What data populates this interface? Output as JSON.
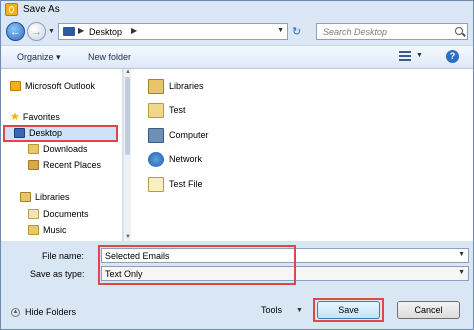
{
  "window": {
    "title": "Save As"
  },
  "address": {
    "path": "Desktop"
  },
  "search": {
    "placeholder": "Search Desktop"
  },
  "toolbar": {
    "organize_label": "Organize",
    "new_folder_label": "New folder"
  },
  "nav": {
    "items": [
      {
        "label": "Microsoft Outlook",
        "icon": "outlook-icon"
      },
      {
        "label": "Favorites",
        "icon": "star-icon"
      },
      {
        "label": "Desktop",
        "icon": "desktop-icon",
        "selected": true
      },
      {
        "label": "Downloads",
        "icon": "downloads-icon"
      },
      {
        "label": "Recent Places",
        "icon": "recent-places-icon"
      },
      {
        "label": "Libraries",
        "icon": "libraries-icon"
      },
      {
        "label": "Documents",
        "icon": "documents-icon"
      },
      {
        "label": "Music",
        "icon": "music-icon"
      }
    ]
  },
  "content": {
    "items": [
      {
        "label": "Libraries",
        "icon": "libraries-icon"
      },
      {
        "label": "Test",
        "icon": "folder-icon"
      },
      {
        "label": "Computer",
        "icon": "computer-icon"
      },
      {
        "label": "Network",
        "icon": "network-icon"
      },
      {
        "label": "Test File",
        "icon": "file-icon"
      }
    ]
  },
  "form": {
    "file_name_label": "File name:",
    "file_name_value": "Selected Emails",
    "save_type_label": "Save as type:",
    "save_type_value": "Text Only"
  },
  "footer": {
    "hide_folders_label": "Hide Folders",
    "tools_label": "Tools",
    "save_label": "Save",
    "cancel_label": "Cancel"
  },
  "colors": {
    "highlight": "#e04848",
    "selection": "#cfe3f8",
    "chrome": "#d9e6f4"
  }
}
